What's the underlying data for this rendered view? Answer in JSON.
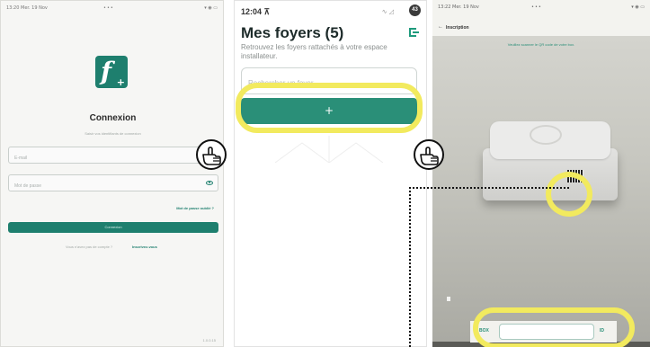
{
  "login_screen": {
    "status_time": "13:20 Mer. 19 Nov",
    "status_center": "•••",
    "status_right": "▾ ◉ ▭",
    "title": "Connexion",
    "subtitle": "Saisir vos identifiants de connexion",
    "email_placeholder": "E-mail",
    "password_placeholder": "Mot de passe",
    "forgot_password": "Mot de passe oublié ?",
    "connect_button": "Connexion",
    "no_account_text": "Vous n'avez pas de compte ?",
    "signup_link": "Inscrivez-vous",
    "version": "1.0.0.15"
  },
  "foyers_screen": {
    "status_time": "12:04 ⊼",
    "status_icons": "∿ ◿",
    "avatar_text": "43",
    "title": "Mes foyers (5)",
    "description": "Retrouvez les foyers rattachés à votre espace installateur.",
    "search_placeholder": "Rechercher un foyer",
    "add_button": "+"
  },
  "scanner_screen": {
    "status_time": "13:22 Mer. 19 Nov",
    "status_center": "•••",
    "status_right": "▾ ◉ ▭",
    "back_icon": "back-arrow",
    "page_title": "Inscription",
    "instruction": "Veuillez scanner le QR code de votre box.",
    "box_label": "BOX",
    "id_label": "ID",
    "id_value": ""
  },
  "annotations": {
    "highlight_color": "#f2ea5e",
    "hand_icon": "pointing-hand-icon"
  },
  "colors": {
    "brand_green": "#1e7f6e",
    "button_green": "#2a8f78"
  }
}
